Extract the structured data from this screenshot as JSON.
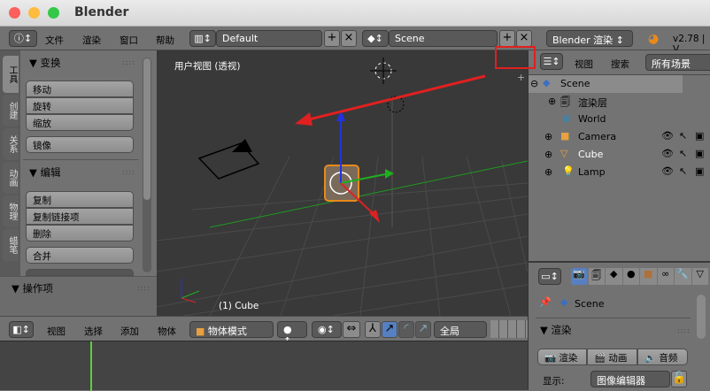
{
  "window": {
    "title": "Blender"
  },
  "topbar": {
    "menus": [
      "文件",
      "渲染",
      "窗口",
      "帮助"
    ],
    "layout": "Default",
    "scene": "Scene",
    "engine": "Blender 渲染",
    "version": "v2.78 | V"
  },
  "toolshelf": {
    "tabs": [
      "工具",
      "创建",
      "关系",
      "动画",
      "物理",
      "蜡笔"
    ],
    "transform": {
      "title": "变换",
      "buttons": [
        "移动",
        "旋转",
        "缩放"
      ],
      "mirror": "镜像"
    },
    "edit": {
      "title": "编辑",
      "buttons": [
        "复制",
        "复制链接项",
        "删除"
      ],
      "join": "合并"
    },
    "operator": {
      "title": "操作项"
    }
  },
  "viewport": {
    "view_label": "用户视图 (透视)",
    "object_label": "(1) Cube"
  },
  "outliner": {
    "menus": [
      "视图",
      "搜索"
    ],
    "filter": "所有场景",
    "items": [
      "Scene",
      "渲染层",
      "World",
      "Camera",
      "Cube",
      "Lamp"
    ]
  },
  "properties": {
    "context": "Scene",
    "section": "渲染",
    "buttons": [
      "渲染",
      "动画",
      "音频"
    ],
    "display_label": "显示:",
    "display_value": "图像编辑器"
  },
  "header3d": {
    "menus": [
      "视图",
      "选择",
      "添加",
      "物体"
    ],
    "mode": "物体模式",
    "orientation": "全局"
  },
  "colors": {
    "annotation": "#e02020",
    "accent_active": "#5680c2",
    "timeline_cursor": "#5bd13a"
  }
}
